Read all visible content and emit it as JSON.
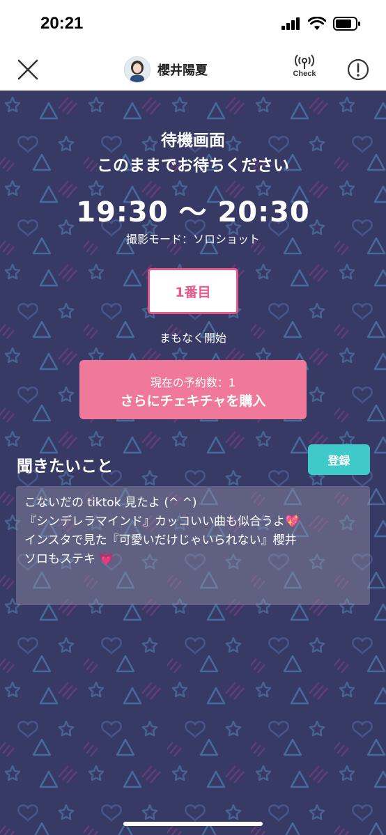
{
  "status_bar": {
    "time": "20:21"
  },
  "nav": {
    "name": "櫻井陽夏",
    "check_label": "Check",
    "icons": {
      "close": "close-icon",
      "check": "broadcast-icon",
      "info": "info-icon"
    }
  },
  "waiting": {
    "heading_line1": "待機画面",
    "heading_line2": "このままでお待ちください",
    "time_range": "19:30 〜 20:30",
    "mode": "撮影モード：ソロショット",
    "rank": "1番目",
    "status": "まもなく開始"
  },
  "purchase": {
    "reservation_count": "現在の予約数：1",
    "button_label": "さらにチェキチャを購入"
  },
  "question": {
    "title": "聞きたいこと",
    "register_label": "登録",
    "lines": [
      "こないだの tiktok 見たよ (^ ^)",
      "『シンデレラマインド』カッコいい曲も似合うよ💖",
      "インスタで見た『可愛いだけじゃいられない』櫻井",
      "ソロもステキ 💗"
    ]
  },
  "colors": {
    "background": "#383a66",
    "accent_pink": "#f0799b",
    "rank_pink": "#e65a8a",
    "register_teal": "#3fc9c8"
  }
}
